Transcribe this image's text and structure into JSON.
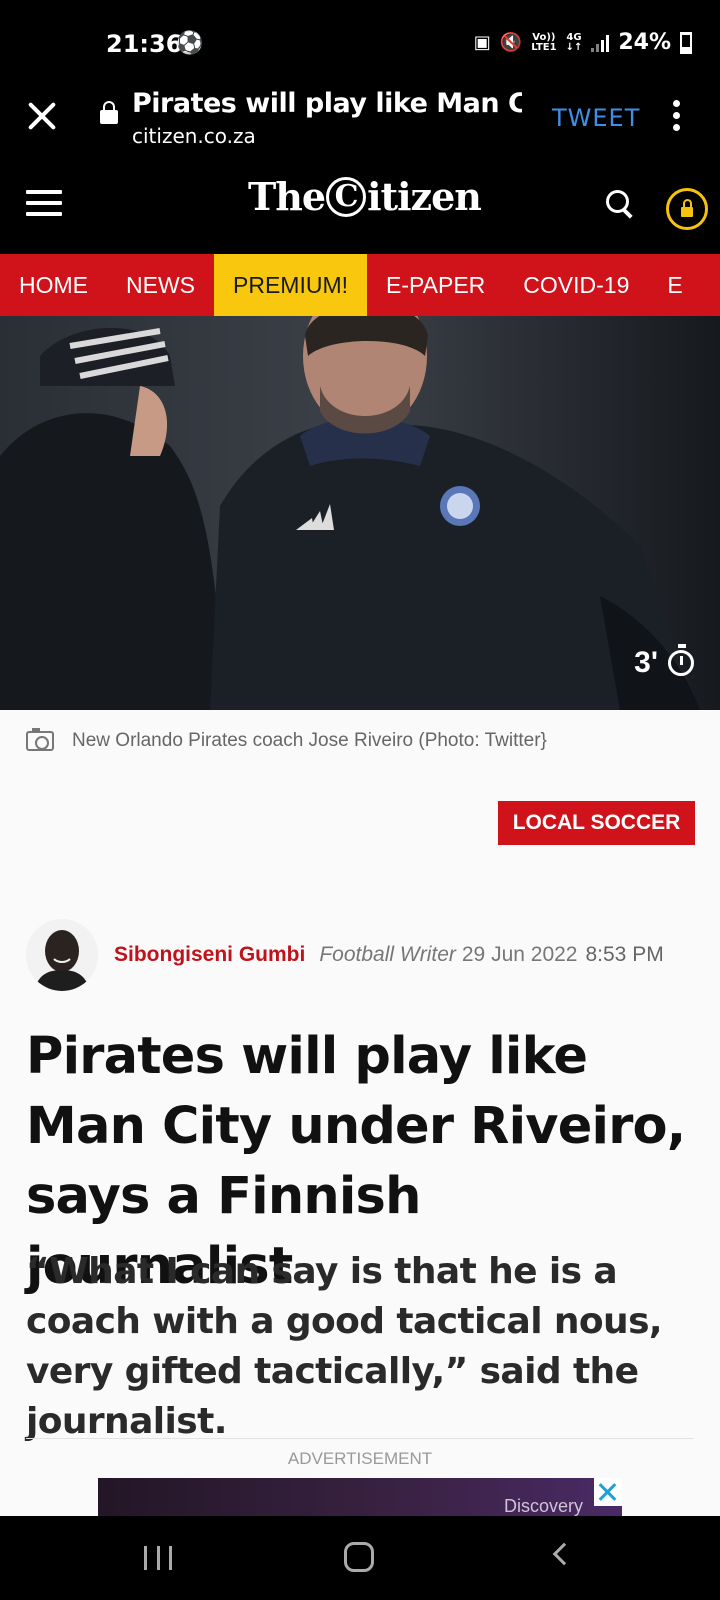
{
  "status_bar": {
    "time": "21:36",
    "battery": "24%",
    "network_line1": "Vo))",
    "network_line2": "LTE1",
    "network_type": "4G"
  },
  "browser": {
    "page_title": "Pirates will play like Man City ...",
    "url": "citizen.co.za",
    "tweet_label": "TWEET"
  },
  "site": {
    "logo_pre": "The",
    "logo_c": "C",
    "logo_post": "itizen",
    "accent_color": "#d0121b",
    "premium_color": "#f9c80e"
  },
  "nav": {
    "items": [
      "HOME",
      "NEWS",
      "PREMIUM!",
      "E-PAPER",
      "COVID-19",
      "E"
    ]
  },
  "hero": {
    "read_time": "3'"
  },
  "caption": "New Orlando Pirates coach Jose Riveiro (Photo: Twitter}",
  "category": "LOCAL SOCCER",
  "author": {
    "name": "Sibongiseni Gumbi",
    "role": "Football Writer",
    "date": "29 Jun 2022",
    "time": "8:53 PM"
  },
  "article": {
    "headline": "Pirates will play like Man City under Riveiro, says a Finnish journalist",
    "standfirst": "“What I can say is that he is a coach with a good tactical nous, very gifted tactically,” said the journalist."
  },
  "ad": {
    "label": "ADVERTISEMENT",
    "brand": "Discovery"
  }
}
